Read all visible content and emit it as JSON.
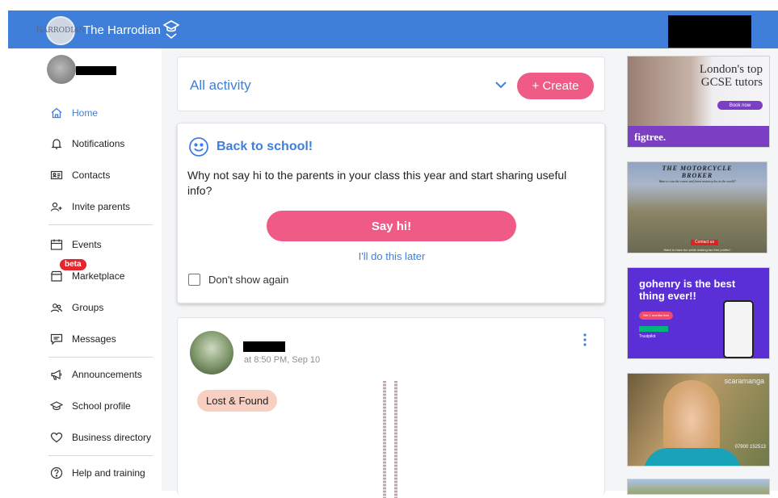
{
  "header": {
    "school_name": "The Harrodian",
    "logo_caption": "HARRODIAN",
    "brand_color": "#3f7fd9",
    "icons": {
      "school_switch": "graduation-cap-chevron-icon"
    }
  },
  "sidebar": {
    "items": [
      {
        "label": "Home",
        "icon": "home-icon",
        "active": true
      },
      {
        "label": "Notifications",
        "icon": "bell-icon"
      },
      {
        "label": "Contacts",
        "icon": "contact-card-icon"
      },
      {
        "label": "Invite parents",
        "icon": "add-user-icon"
      },
      {
        "label": "Events",
        "icon": "calendar-icon"
      },
      {
        "label": "Marketplace",
        "icon": "shop-icon",
        "badge": "beta"
      },
      {
        "label": "Groups",
        "icon": "groups-icon"
      },
      {
        "label": "Messages",
        "icon": "message-icon"
      },
      {
        "label": "Announcements",
        "icon": "megaphone-icon"
      },
      {
        "label": "School profile",
        "icon": "graduation-cap-icon"
      },
      {
        "label": "Business directory",
        "icon": "heart-icon"
      },
      {
        "label": "Help and training",
        "icon": "help-icon"
      }
    ]
  },
  "feed": {
    "filter_label": "All activity",
    "create_label": "+ Create",
    "accent_color": "#f05a86"
  },
  "back_to_school": {
    "title": "Back to school!",
    "text": "Why not say hi to the parents in your class this year and start sharing useful info?",
    "cta_label": "Say hi!",
    "later_label": "I'll do this later",
    "dont_show_label": "Don't show again"
  },
  "post": {
    "time": "at 8:50 PM, Sep 10",
    "tag": "Lost & Found"
  },
  "ads": [
    {
      "headline": "London's top GCSE tutors",
      "button": "Book now",
      "brand": "figtree."
    },
    {
      "headline": "THE MOTORCYCLE BROKER",
      "subline": "Want to own the rarest and finest motorcycles in the world?",
      "footer": "Want to have fun while making tax free profits?",
      "badge": "Contact us"
    },
    {
      "headline": "gohenry is the best thing ever!!",
      "button": "Get 1 months free",
      "rating": "Trustpilot"
    },
    {
      "brand": "scaramanga",
      "phone": "07900 152513"
    },
    {}
  ]
}
